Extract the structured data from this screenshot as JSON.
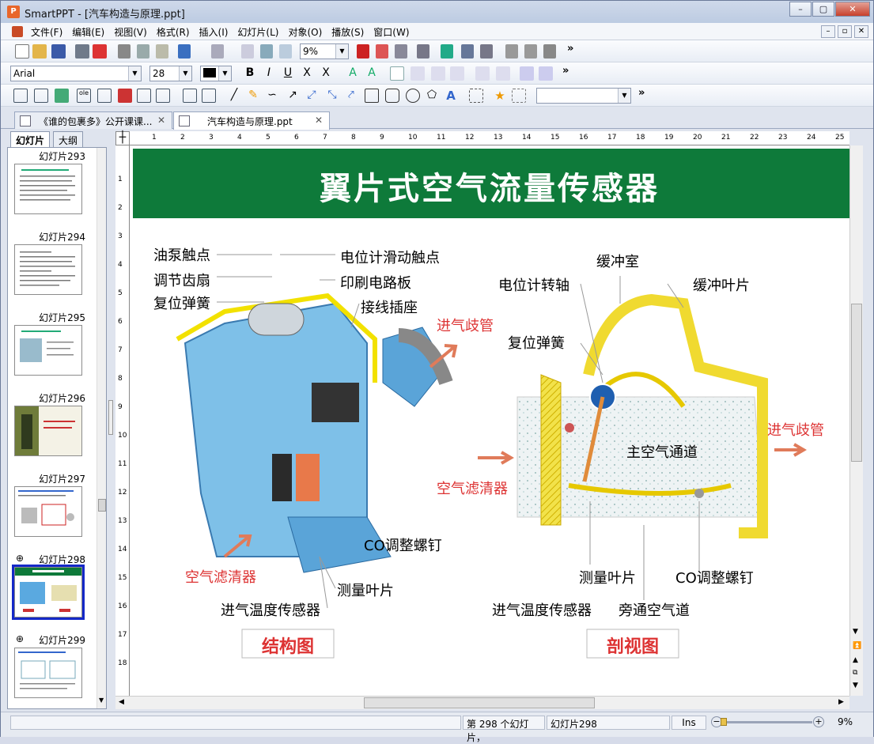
{
  "window": {
    "app_name": "SmartPPT",
    "title": "SmartPPT - [汽车构造与原理.ppt]",
    "app_icon": "P",
    "controls": [
      "–",
      "▢",
      "✕"
    ]
  },
  "menu": [
    "文件(F)",
    "编辑(E)",
    "视图(V)",
    "格式(R)",
    "插入(I)",
    "幻灯片(L)",
    "对象(O)",
    "播放(S)",
    "窗口(W)"
  ],
  "toolbar1": {
    "zoom_value": "9%",
    "more": "»"
  },
  "toolbar2": {
    "font_name": "Arial",
    "font_size": "28",
    "more": "»"
  },
  "toolbar3": {
    "object_combo_value": "",
    "more": "»"
  },
  "doc_tabs": [
    {
      "label": "《谁的包裹多》公开课课...",
      "close": "✕",
      "active": false
    },
    {
      "label": "汽车构造与原理.ppt",
      "close": "✕",
      "active": true
    }
  ],
  "side_tabs": [
    "幻灯片",
    "大纲"
  ],
  "thumbnails": [
    {
      "label": "幻灯片293",
      "has_anim": false
    },
    {
      "label": "幻灯片294",
      "has_anim": false
    },
    {
      "label": "幻灯片295",
      "has_anim": false
    },
    {
      "label": "幻灯片296",
      "has_anim": false
    },
    {
      "label": "幻灯片297",
      "has_anim": false
    },
    {
      "label": "幻灯片298",
      "has_anim": true
    },
    {
      "label": "幻灯片299",
      "has_anim": true
    }
  ],
  "ruler_h_numbers": [
    "1",
    "2",
    "3",
    "4",
    "5",
    "6",
    "7",
    "8",
    "9",
    "10",
    "11",
    "12",
    "13",
    "14",
    "15",
    "16",
    "17",
    "18",
    "19",
    "20",
    "21",
    "22",
    "23",
    "24",
    "25"
  ],
  "ruler_v_numbers": [
    "1",
    "2",
    "3",
    "4",
    "5",
    "6",
    "7",
    "8",
    "9",
    "10",
    "11",
    "12",
    "13",
    "14",
    "15",
    "16",
    "17",
    "18"
  ],
  "slide": {
    "title": "翼片式空气流量传感器",
    "header_color": "#0e7a3a",
    "left_labels": {
      "oil_pump_contact": "油泵触点",
      "adjust_gear": "调节齿扇",
      "reset_spring": "复位弹簧",
      "pot_slide_contact": "电位计滑动触点",
      "pcb": "印刷电路板",
      "connector": "接线插座",
      "intake_manifold": "进气歧管",
      "co_screw": "CO调整螺钉",
      "air_filter": "空气滤清器",
      "measure_vane": "测量叶片",
      "intake_temp_sensor": "进气温度传感器"
    },
    "right_labels": {
      "buffer_chamber": "缓冲室",
      "pot_shaft": "电位计转轴",
      "buffer_vane": "缓冲叶片",
      "reset_spring": "复位弹簧",
      "intake_manifold": "进气歧管",
      "main_air_passage": "主空气通道",
      "air_filter": "空气滤清器",
      "measure_vane": "测量叶片",
      "co_screw": "CO调整螺钉",
      "intake_temp_sensor": "进气温度传感器",
      "bypass_air": "旁通空气道"
    },
    "caption_left": "结构图",
    "caption_right": "剖视图"
  },
  "status": {
    "slide_position": "第 298 个幻灯片，",
    "slide_name": "幻灯片298",
    "mode": "Ins",
    "zoom": "9%"
  }
}
